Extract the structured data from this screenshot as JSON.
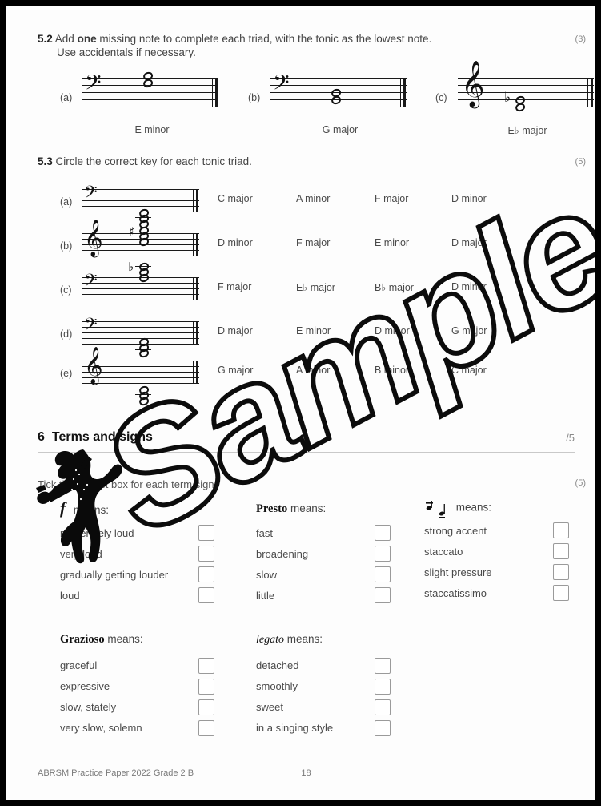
{
  "watermark": {
    "text": "Sample",
    "figure": "guitarist-silhouette"
  },
  "q52": {
    "number": "5.2",
    "text_bold": "one",
    "text_before": "Add ",
    "text_after": " missing note to complete each triad, with the tonic as the lowest note.",
    "line2": "Use accidentals if necessary.",
    "marks": "(3)",
    "items": [
      {
        "label": "(a)",
        "clef": "bass-clef",
        "key": "E minor",
        "accidental": ""
      },
      {
        "label": "(b)",
        "clef": "bass-clef",
        "key": "G major",
        "accidental": ""
      },
      {
        "label": "(c)",
        "clef": "treble-clef",
        "key": "E♭ major",
        "accidental": "♭"
      }
    ]
  },
  "q53": {
    "number": "5.3",
    "text": "Circle the correct key for each tonic triad.",
    "marks": "(5)",
    "rows": [
      {
        "label": "(a)",
        "clef": "bass-clef",
        "accidental": "",
        "options": [
          "C major",
          "A minor",
          "F major",
          "D minor"
        ]
      },
      {
        "label": "(b)",
        "clef": "treble-clef",
        "accidental": "♯",
        "options": [
          "D minor",
          "F major",
          "E minor",
          "D major"
        ]
      },
      {
        "label": "(c)",
        "clef": "bass-clef",
        "accidental": "♭",
        "options": [
          "F major",
          "E♭ major",
          "B♭ major",
          "D minor"
        ]
      },
      {
        "label": "(d)",
        "clef": "bass-clef",
        "accidental": "",
        "options": [
          "D major",
          "E minor",
          "D minor",
          "G major"
        ]
      },
      {
        "label": "(e)",
        "clef": "treble-clef",
        "accidental": "",
        "options": [
          "G major",
          "A minor",
          "B minor",
          "C major"
        ]
      }
    ]
  },
  "section6": {
    "number": "6",
    "title": "Terms and signs",
    "score": "/5",
    "score_total": "5",
    "instruction": "Tick the correct box for each term/sign.",
    "marks": "(5)",
    "blocks": [
      {
        "term": "f",
        "term_kind": "dynamic-forte",
        "means": "means:",
        "options": [
          "moderately loud",
          "very loud",
          "gradually getting louder",
          "loud"
        ]
      },
      {
        "term": "Presto",
        "term_kind": "bold-italic-term",
        "means": "means:",
        "options": [
          "fast",
          "broadening",
          "slow",
          "little"
        ]
      },
      {
        "term": "tenuto-mark",
        "term_kind": "notation-sign",
        "means": "means:",
        "options": [
          "strong accent",
          "staccato",
          "slight pressure",
          "staccatissimo"
        ]
      },
      {
        "term": "Grazioso",
        "term_kind": "bold-term",
        "means": "means:",
        "options": [
          "graceful",
          "expressive",
          "slow, stately",
          "very slow, solemn"
        ]
      },
      {
        "term": "legato",
        "term_kind": "italic-term",
        "means": "means:",
        "options": [
          "detached",
          "smoothly",
          "sweet",
          "in a singing style"
        ]
      }
    ]
  },
  "footer": {
    "left": "ABRSM Practice Paper 2022 Grade 2 B",
    "page": "18"
  }
}
